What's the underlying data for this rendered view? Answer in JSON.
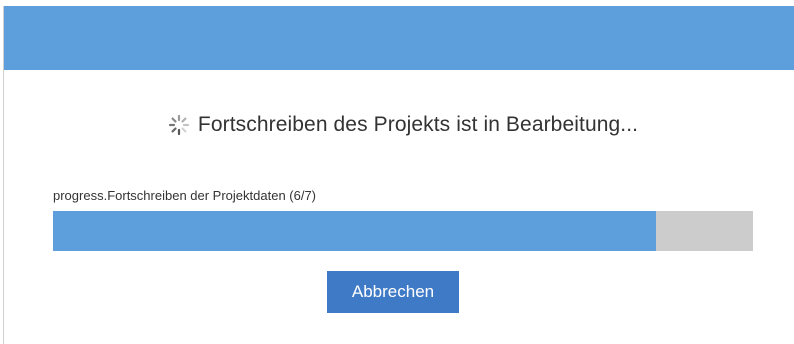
{
  "dialog": {
    "status_text": "Fortschreiben des Projekts ist in Bearbeitung...",
    "status_icon": "spinner-icon",
    "progress": {
      "label": "progress.Fortschreiben der Projektdaten (6/7)",
      "fraction": 0.862
    },
    "cancel_label": "Abbrechen"
  },
  "colors": {
    "header": "#5c9fdc",
    "progress_fill": "#5c9fdc",
    "progress_track": "#cccccc",
    "button": "#3f7ac6"
  }
}
